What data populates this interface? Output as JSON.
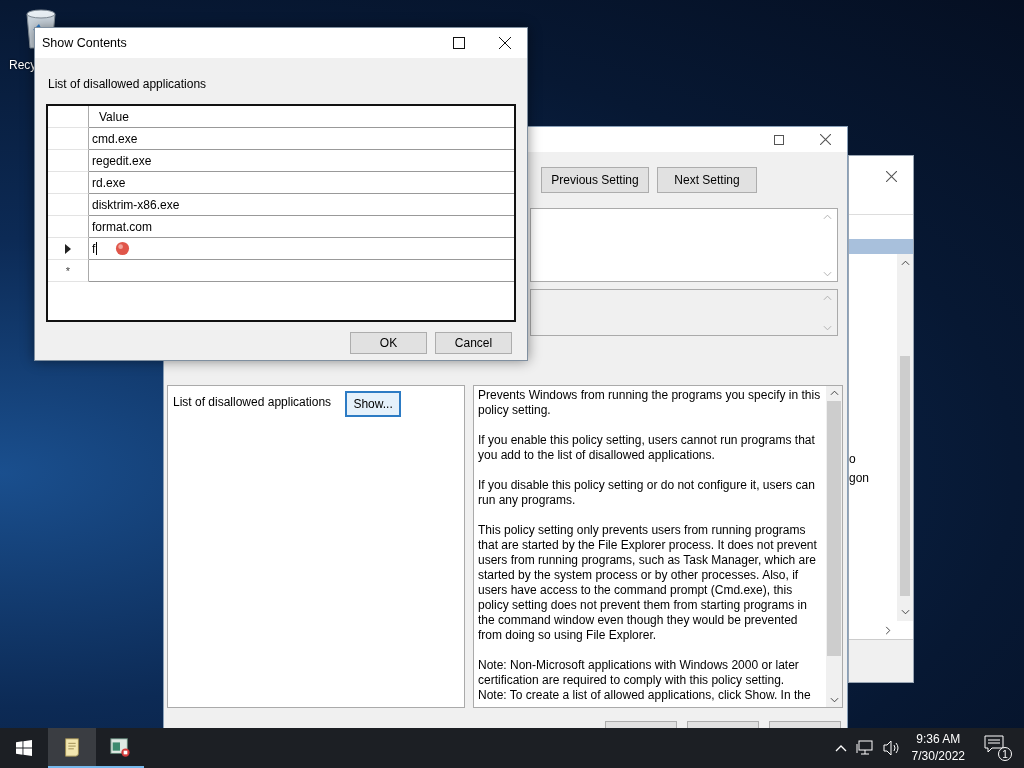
{
  "desktop": {
    "icons": [
      {
        "label": "Recy"
      }
    ]
  },
  "background_window": {
    "list_fragments": [
      "o",
      "gon"
    ]
  },
  "policy_window": {
    "buttons": [
      "Previous Setting",
      "Next Setting"
    ],
    "option": {
      "label": "List of disallowed applications",
      "button": "Show..."
    },
    "help": [
      "Prevents Windows from running the programs you specify in this policy setting.",
      "If you enable this policy setting, users cannot run programs that you add to the list of disallowed applications.",
      "If you disable this policy setting or do not configure it, users can run any programs.",
      "This policy setting only prevents users from running programs that are started by the File Explorer process. It does not prevent users from running programs, such as Task Manager, which are started by the system process or by other processes.  Also, if users have access to the command prompt (Cmd.exe), this policy setting does not prevent them from starting programs in the command window even though they would be prevented from doing so using File Explorer.",
      "Note: Non-Microsoft applications with Windows 2000 or later certification are required to comply with this policy setting.\nNote: To create a list of allowed applications, click Show.  In the"
    ]
  },
  "dialog": {
    "title": "Show Contents",
    "label": "List of disallowed applications",
    "column": "Value",
    "rows": [
      {
        "value": "cmd.exe",
        "selected": false
      },
      {
        "value": "regedit.exe",
        "selected": false
      },
      {
        "value": "rd.exe",
        "selected": false
      },
      {
        "value": "disktrim-x86.exe",
        "selected": false
      },
      {
        "value": "format.com",
        "selected": false
      },
      {
        "value": "f",
        "selected": true
      }
    ],
    "new_row_marker": "*",
    "buttons": [
      "OK",
      "Cancel"
    ]
  },
  "taskbar": {
    "apps": [
      {
        "kind": "notepad"
      },
      {
        "kind": "editor"
      }
    ],
    "time": "9:36 AM",
    "date": "7/30/2022",
    "notifications": "1"
  }
}
